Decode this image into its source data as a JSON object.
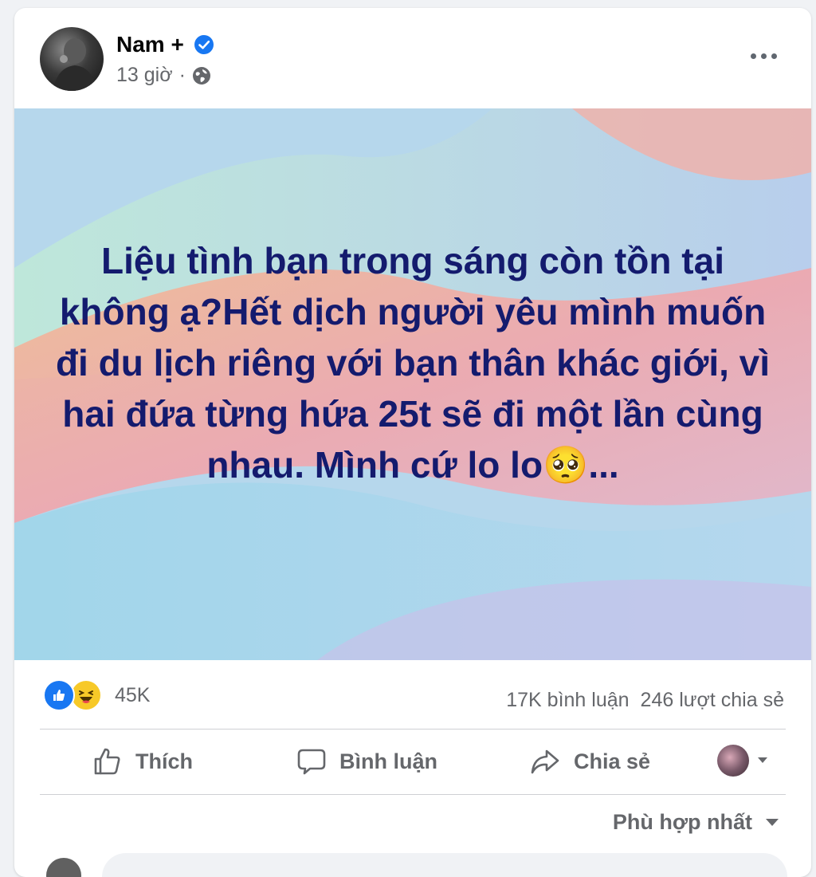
{
  "post": {
    "author": "Nam +",
    "time": "13 giờ",
    "separator": "·",
    "text": "Liệu tình bạn trong sáng còn tồn tại không ạ?Hết dịch người yêu mình muốn đi du lịch riêng với bạn thân khác giới, vì hai đứa từng hứa 25t sẽ đi một lần cùng nhau. Mình cứ lo lo🥺...",
    "text_color": "#141b6e"
  },
  "stats": {
    "reaction_count": "45K",
    "comments": "17K bình luận",
    "shares": "246 lượt chia sẻ",
    "reaction_icons": [
      "like-icon",
      "haha-icon"
    ]
  },
  "actions": {
    "like": "Thích",
    "comment": "Bình luận",
    "share": "Chia sẻ"
  },
  "comments": {
    "sort_label": "Phù hợp nhất"
  },
  "colors": {
    "accent": "#1877f2",
    "secondary_text": "#65676b",
    "haha": "#f7c928"
  }
}
